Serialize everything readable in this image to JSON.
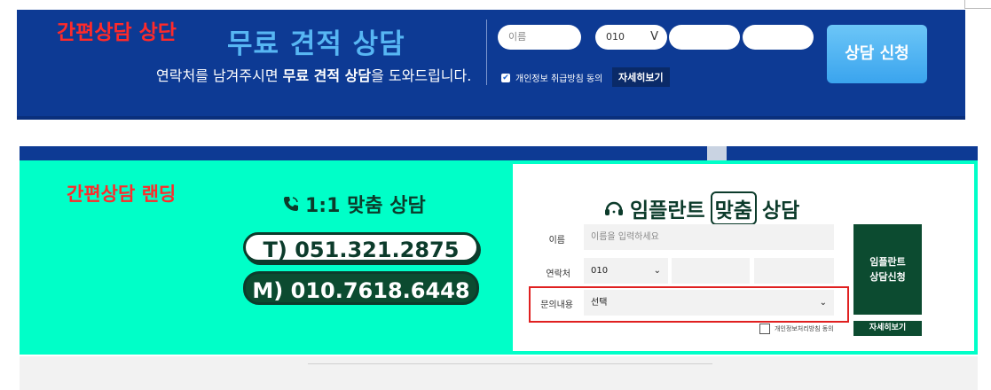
{
  "top_banner": {
    "tag": "간편상담 상단",
    "title": "무료 견적 상담",
    "subtitle_pre": "연락처를 남겨주시면 ",
    "subtitle_bold": "무료 견적 상담",
    "subtitle_post": "을 도와드립니다.",
    "name_placeholder": "이름",
    "phone_prefix": "010",
    "phone_chevron": "V",
    "agree_label": "개인정보 취급방침 동의",
    "detail_button": "자세히보기",
    "submit_button": "상담 신청"
  },
  "landing": {
    "tag": "간편상담 랜딩",
    "heading": "1:1 맞춤 상담",
    "heading_icon": "phone-icon",
    "tel": "T) 051.321.2875",
    "mobile": "M) 010.7618.6448",
    "form": {
      "title_pre": "임플란트",
      "title_highlight": "맞춤",
      "title_post": "상담",
      "title_icon": "headset-icon",
      "name_label": "이름",
      "name_placeholder": "이름을 입력하세요",
      "contact_label": "연락처",
      "phone_prefix": "010",
      "inquiry_label": "문의내용",
      "inquiry_value": "선택",
      "submit_line1": "임플란트",
      "submit_line2": "상담신청",
      "agree_label": "개인정보처리방침 동의",
      "detail_button": "자세히보기"
    }
  },
  "colors": {
    "banner_blue": "#0d3a94",
    "mint": "#00ffc8",
    "dark_green": "#0c4b30",
    "annotation_red": "#ff2a2a"
  }
}
